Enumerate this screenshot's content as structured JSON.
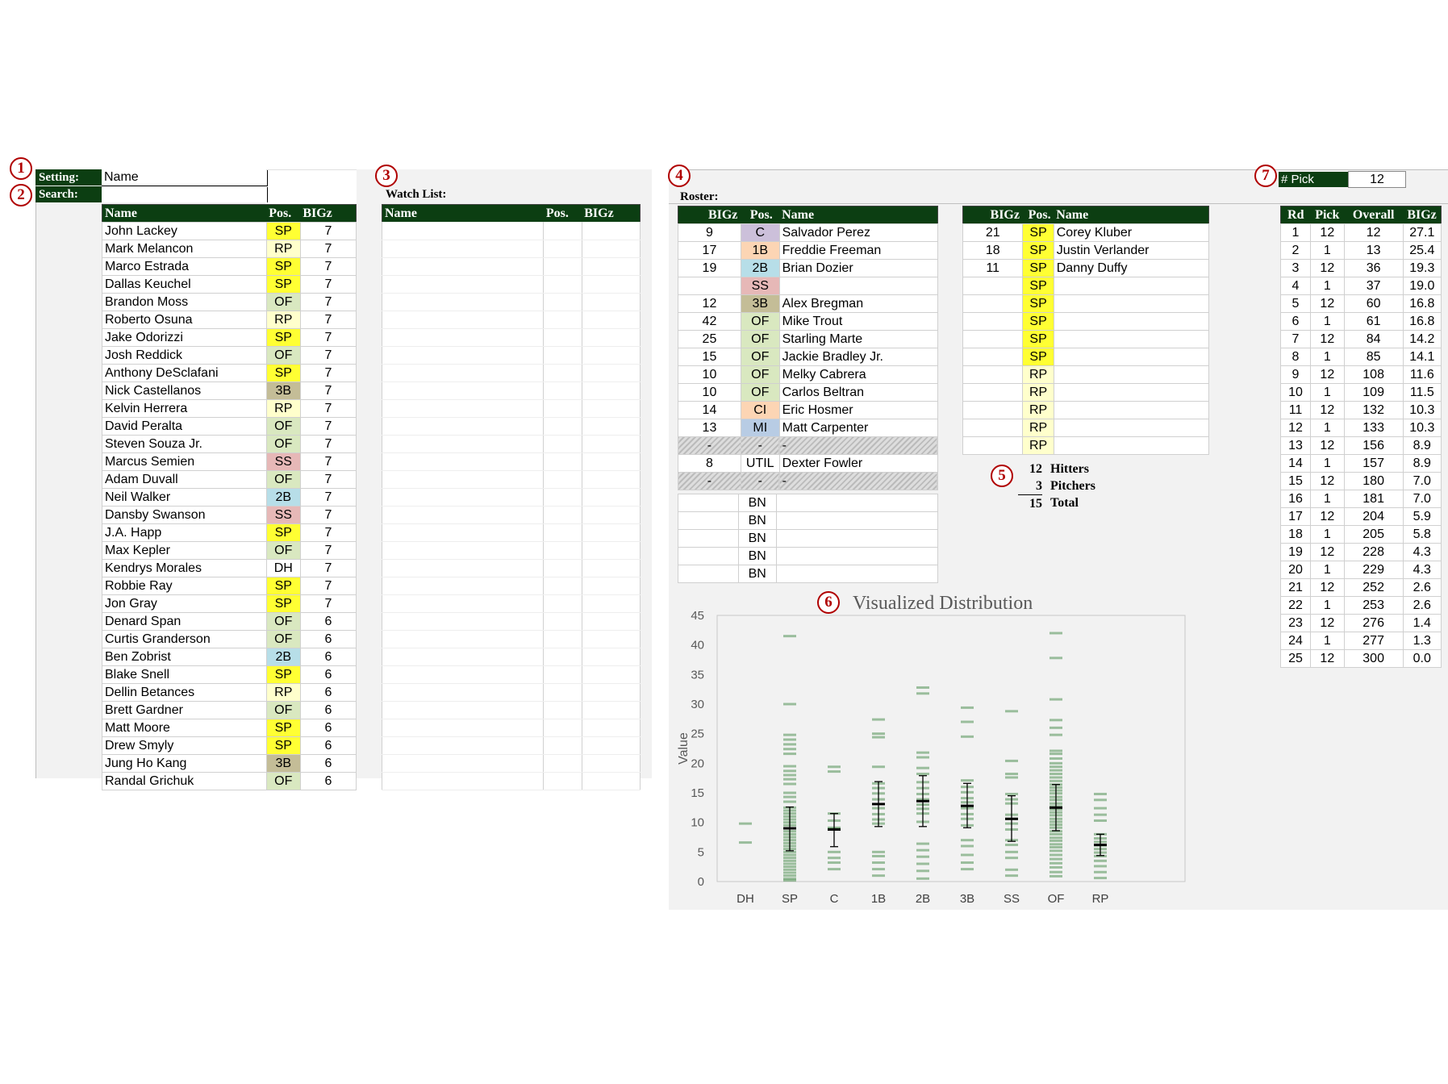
{
  "colors": {
    "header_green": "#0c3e12",
    "SP": "#ffff33",
    "RP": "#ffffcc",
    "OF": "#d9e8c0",
    "3B": "#c4bd97",
    "SS": "#e6b8b7",
    "2B": "#b7dee8",
    "1B": "#fcd5b4",
    "C": "#ccc0da",
    "CI": "#fcd5b4",
    "MI": "#b8cce4",
    "badge": "#b00000",
    "chart_mark": "#2e7d32"
  },
  "badges": [
    "1",
    "2",
    "3",
    "4",
    "5",
    "6",
    "7"
  ],
  "settings": {
    "setting_label": "Setting:",
    "setting_value": "Name",
    "search_label": "Search:",
    "search_value": ""
  },
  "player_list": {
    "headers": [
      "Name",
      "Pos.",
      "BIGz"
    ],
    "rows": [
      [
        "John Lackey",
        "SP",
        "7"
      ],
      [
        "Mark Melancon",
        "RP",
        "7"
      ],
      [
        "Marco Estrada",
        "SP",
        "7"
      ],
      [
        "Dallas Keuchel",
        "SP",
        "7"
      ],
      [
        "Brandon Moss",
        "OF",
        "7"
      ],
      [
        "Roberto Osuna",
        "RP",
        "7"
      ],
      [
        "Jake Odorizzi",
        "SP",
        "7"
      ],
      [
        "Josh Reddick",
        "OF",
        "7"
      ],
      [
        "Anthony DeSclafani",
        "SP",
        "7"
      ],
      [
        "Nick Castellanos",
        "3B",
        "7"
      ],
      [
        "Kelvin Herrera",
        "RP",
        "7"
      ],
      [
        "David Peralta",
        "OF",
        "7"
      ],
      [
        "Steven Souza Jr.",
        "OF",
        "7"
      ],
      [
        "Marcus Semien",
        "SS",
        "7"
      ],
      [
        "Adam Duvall",
        "OF",
        "7"
      ],
      [
        "Neil Walker",
        "2B",
        "7"
      ],
      [
        "Dansby Swanson",
        "SS",
        "7"
      ],
      [
        "J.A. Happ",
        "SP",
        "7"
      ],
      [
        "Max Kepler",
        "OF",
        "7"
      ],
      [
        "Kendrys Morales",
        "DH",
        "7"
      ],
      [
        "Robbie Ray",
        "SP",
        "7"
      ],
      [
        "Jon Gray",
        "SP",
        "7"
      ],
      [
        "Denard Span",
        "OF",
        "6"
      ],
      [
        "Curtis Granderson",
        "OF",
        "6"
      ],
      [
        "Ben Zobrist",
        "2B",
        "6"
      ],
      [
        "Blake Snell",
        "SP",
        "6"
      ],
      [
        "Dellin Betances",
        "RP",
        "6"
      ],
      [
        "Brett Gardner",
        "OF",
        "6"
      ],
      [
        "Matt Moore",
        "SP",
        "6"
      ],
      [
        "Drew Smyly",
        "SP",
        "6"
      ],
      [
        "Jung Ho Kang",
        "3B",
        "6"
      ],
      [
        "Randal Grichuk",
        "OF",
        "6"
      ]
    ]
  },
  "watch_list": {
    "title": "Watch List:",
    "headers": [
      "Name",
      "Pos.",
      "BIGz"
    ],
    "empty_rows": 32
  },
  "roster": {
    "title": "Roster:",
    "hitters_headers": [
      "BIGz",
      "Pos.",
      "Name"
    ],
    "hitters": [
      [
        "9",
        "C",
        "Salvador Perez"
      ],
      [
        "17",
        "1B",
        "Freddie Freeman"
      ],
      [
        "19",
        "2B",
        "Brian Dozier"
      ],
      [
        "",
        "SS",
        ""
      ],
      [
        "12",
        "3B",
        "Alex Bregman"
      ],
      [
        "42",
        "OF",
        "Mike Trout"
      ],
      [
        "25",
        "OF",
        "Starling Marte"
      ],
      [
        "15",
        "OF",
        "Jackie Bradley Jr."
      ],
      [
        "10",
        "OF",
        "Melky Cabrera"
      ],
      [
        "10",
        "OF",
        "Carlos Beltran"
      ],
      [
        "14",
        "CI",
        "Eric Hosmer"
      ],
      [
        "13",
        "MI",
        "Matt Carpenter"
      ],
      [
        "-",
        "-",
        "-"
      ],
      [
        "8",
        "UTIL",
        "Dexter Fowler"
      ],
      [
        "-",
        "-",
        "-"
      ]
    ],
    "bench": [
      "BN",
      "BN",
      "BN",
      "BN",
      "BN"
    ],
    "pitchers_headers": [
      "BIGz",
      "Pos.",
      "Name"
    ],
    "pitchers": [
      [
        "21",
        "SP",
        "Corey Kluber"
      ],
      [
        "18",
        "SP",
        "Justin Verlander"
      ],
      [
        "11",
        "SP",
        "Danny Duffy"
      ],
      [
        "",
        "SP",
        ""
      ],
      [
        "",
        "SP",
        ""
      ],
      [
        "",
        "SP",
        ""
      ],
      [
        "",
        "SP",
        ""
      ],
      [
        "",
        "SP",
        ""
      ],
      [
        "",
        "RP",
        ""
      ],
      [
        "",
        "RP",
        ""
      ],
      [
        "",
        "RP",
        ""
      ],
      [
        "",
        "RP",
        ""
      ],
      [
        "",
        "RP",
        ""
      ]
    ]
  },
  "summary": [
    {
      "count": "12",
      "label": "Hitters"
    },
    {
      "count": "3",
      "label": "Pitchers"
    },
    {
      "count": "15",
      "label": "Total"
    }
  ],
  "pick": {
    "label": "# Pick",
    "value": "12",
    "headers": [
      "Rd",
      "Pick",
      "Overall",
      "BIGz"
    ],
    "rows": [
      [
        "1",
        "12",
        "12",
        "27.1"
      ],
      [
        "2",
        "1",
        "13",
        "25.4"
      ],
      [
        "3",
        "12",
        "36",
        "19.3"
      ],
      [
        "4",
        "1",
        "37",
        "19.0"
      ],
      [
        "5",
        "12",
        "60",
        "16.8"
      ],
      [
        "6",
        "1",
        "61",
        "16.8"
      ],
      [
        "7",
        "12",
        "84",
        "14.2"
      ],
      [
        "8",
        "1",
        "85",
        "14.1"
      ],
      [
        "9",
        "12",
        "108",
        "11.6"
      ],
      [
        "10",
        "1",
        "109",
        "11.5"
      ],
      [
        "11",
        "12",
        "132",
        "10.3"
      ],
      [
        "12",
        "1",
        "133",
        "10.3"
      ],
      [
        "13",
        "12",
        "156",
        "8.9"
      ],
      [
        "14",
        "1",
        "157",
        "8.9"
      ],
      [
        "15",
        "12",
        "180",
        "7.0"
      ],
      [
        "16",
        "1",
        "181",
        "7.0"
      ],
      [
        "17",
        "12",
        "204",
        "5.9"
      ],
      [
        "18",
        "1",
        "205",
        "5.8"
      ],
      [
        "19",
        "12",
        "228",
        "4.3"
      ],
      [
        "20",
        "1",
        "229",
        "4.3"
      ],
      [
        "21",
        "12",
        "252",
        "2.6"
      ],
      [
        "22",
        "1",
        "253",
        "2.6"
      ],
      [
        "23",
        "12",
        "276",
        "1.4"
      ],
      [
        "24",
        "1",
        "277",
        "1.3"
      ],
      [
        "25",
        "12",
        "300",
        "0.0"
      ]
    ]
  },
  "chart_data": {
    "type": "scatter",
    "title": "Visualized Distribution",
    "xlabel": "",
    "ylabel": "Value",
    "ylim": [
      0,
      45
    ],
    "yticks": [
      0,
      5,
      10,
      15,
      20,
      25,
      30,
      35,
      40,
      45
    ],
    "categories": [
      "DH",
      "SP",
      "C",
      "1B",
      "2B",
      "3B",
      "SS",
      "OF",
      "RP"
    ],
    "series": [
      {
        "category": "DH",
        "values": [
          9.8,
          6.6
        ]
      },
      {
        "category": "SP",
        "values": [
          41.5,
          30,
          24.8,
          24,
          23.2,
          22.4,
          21.6,
          19.5,
          18.7,
          18,
          17.3,
          16.5,
          15,
          14.3,
          13.5,
          12.5,
          12,
          11.5,
          11,
          10.5,
          10,
          9.5,
          9,
          8.5,
          8,
          7.5,
          7,
          6.5,
          6,
          5.5,
          5,
          4.5,
          4,
          3.5,
          3,
          2.5,
          2,
          1.5,
          1,
          0.5,
          0.2
        ]
      },
      {
        "category": "C",
        "values": [
          19.4,
          18.6,
          11.5,
          10.3,
          9.1,
          8.9,
          8.8,
          5,
          4,
          3.2,
          2.1
        ]
      },
      {
        "category": "1B",
        "values": [
          27.4,
          25,
          24.4,
          19.4,
          16.6,
          15.8,
          14.9,
          13.9,
          12.4,
          11.4,
          10.5,
          9.8,
          5,
          4.3,
          3.2,
          2.1,
          1
        ]
      },
      {
        "category": "2B",
        "values": [
          32.8,
          31.8,
          21.8,
          21,
          19.2,
          18.2,
          16.8,
          15.8,
          14.8,
          13.9,
          13,
          12.3,
          11.5,
          10.1,
          6.4,
          5.3,
          4.2,
          3,
          1.8,
          0.5
        ]
      },
      {
        "category": "3B",
        "values": [
          29.4,
          27,
          24.5,
          17.1,
          16,
          15.1,
          14.1,
          13.4,
          12.4,
          11.4,
          10.6,
          9.5,
          7,
          6,
          4.5,
          3.2,
          2.1
        ]
      },
      {
        "category": "SS",
        "values": [
          28.8,
          20.4,
          18.2,
          17.6,
          14.8,
          13.9,
          13.2,
          11.3,
          10.6,
          9.8,
          8.8,
          7,
          6.2,
          5,
          4,
          2,
          1
        ]
      },
      {
        "category": "OF",
        "values": [
          42,
          37.8,
          30.8,
          27.3,
          26,
          24.8,
          22.1,
          21.6,
          20.8,
          20,
          19.4,
          18.8,
          18.2,
          17.6,
          17,
          16.4,
          15.9,
          15.4,
          14.9,
          14.3,
          13.8,
          13.2,
          12.7,
          12.2,
          11.7,
          11.2,
          10.6,
          10.1,
          9.6,
          9.1,
          8.5,
          8,
          7.4,
          6.9,
          6.3,
          5.8,
          5.2,
          4.5,
          3.8,
          3.1,
          2.4,
          1.6,
          0.9
        ]
      },
      {
        "category": "RP",
        "values": [
          14.8,
          13.8,
          12.4,
          11.3,
          10.3,
          8,
          7.3,
          6.7,
          6.1,
          5.5,
          4.9,
          4.3,
          3.5,
          2.6,
          1.6,
          0.6
        ]
      }
    ],
    "summary_stats": [
      {
        "category": "SP",
        "mean": 9,
        "low": 5.2,
        "high": 12.6
      },
      {
        "category": "C",
        "mean": 8.8,
        "low": 5.9,
        "high": 11.5
      },
      {
        "category": "1B",
        "mean": 13.1,
        "low": 9.3,
        "high": 16.9
      },
      {
        "category": "2B",
        "mean": 13.6,
        "low": 9.3,
        "high": 17.9
      },
      {
        "category": "3B",
        "mean": 12.8,
        "low": 9.1,
        "high": 16.6
      },
      {
        "category": "SS",
        "mean": 10.6,
        "low": 6.8,
        "high": 14.5
      },
      {
        "category": "OF",
        "mean": 12.5,
        "low": 8.6,
        "high": 16.4
      },
      {
        "category": "RP",
        "mean": 6.2,
        "low": 4.4,
        "high": 8
      }
    ]
  }
}
